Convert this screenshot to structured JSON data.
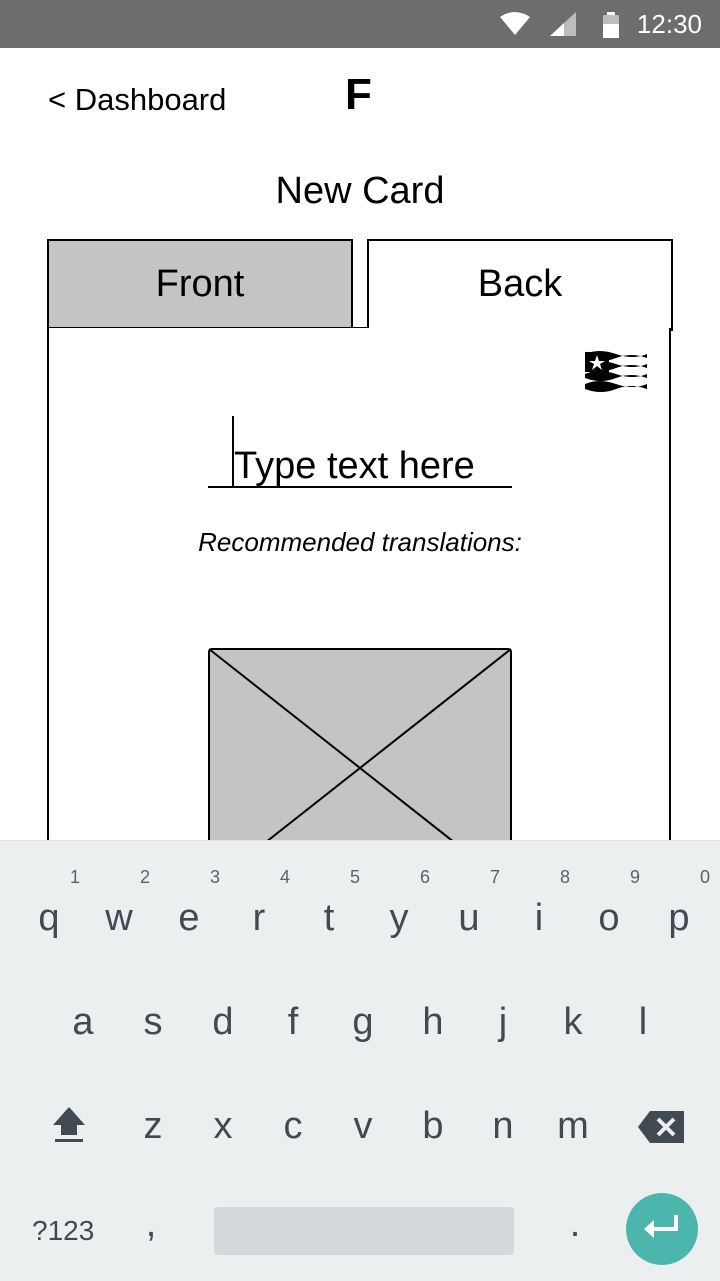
{
  "status_bar": {
    "time": "12:30",
    "icons": [
      "wifi-icon",
      "signal-icon",
      "battery-icon"
    ]
  },
  "header": {
    "back_label": "< Dashboard",
    "logo": "F",
    "title": "New Card"
  },
  "tabs": [
    {
      "label": "Front",
      "selected": false
    },
    {
      "label": "Back",
      "selected": true
    }
  ],
  "card": {
    "language_flag": "flag-icon",
    "input_placeholder": "Type text here",
    "recommendations_label": "Recommended translations:",
    "image": "image-placeholder"
  },
  "keyboard": {
    "row1": [
      {
        "k": "q",
        "h": "1"
      },
      {
        "k": "w",
        "h": "2"
      },
      {
        "k": "e",
        "h": "3"
      },
      {
        "k": "r",
        "h": "4"
      },
      {
        "k": "t",
        "h": "5"
      },
      {
        "k": "y",
        "h": "6"
      },
      {
        "k": "u",
        "h": "7"
      },
      {
        "k": "i",
        "h": "8"
      },
      {
        "k": "o",
        "h": "9"
      },
      {
        "k": "p",
        "h": "0"
      }
    ],
    "row2": [
      "a",
      "s",
      "d",
      "f",
      "g",
      "h",
      "j",
      "k",
      "l"
    ],
    "row3": [
      "z",
      "x",
      "c",
      "v",
      "b",
      "n",
      "m"
    ],
    "symbols_label": "?123",
    "comma": ",",
    "period": "."
  },
  "colors": {
    "accent": "#4db6ac",
    "tab_inactive": "#c4c4c4",
    "status_bar": "#6d6d6d",
    "keyboard_bg": "#eceff0"
  }
}
